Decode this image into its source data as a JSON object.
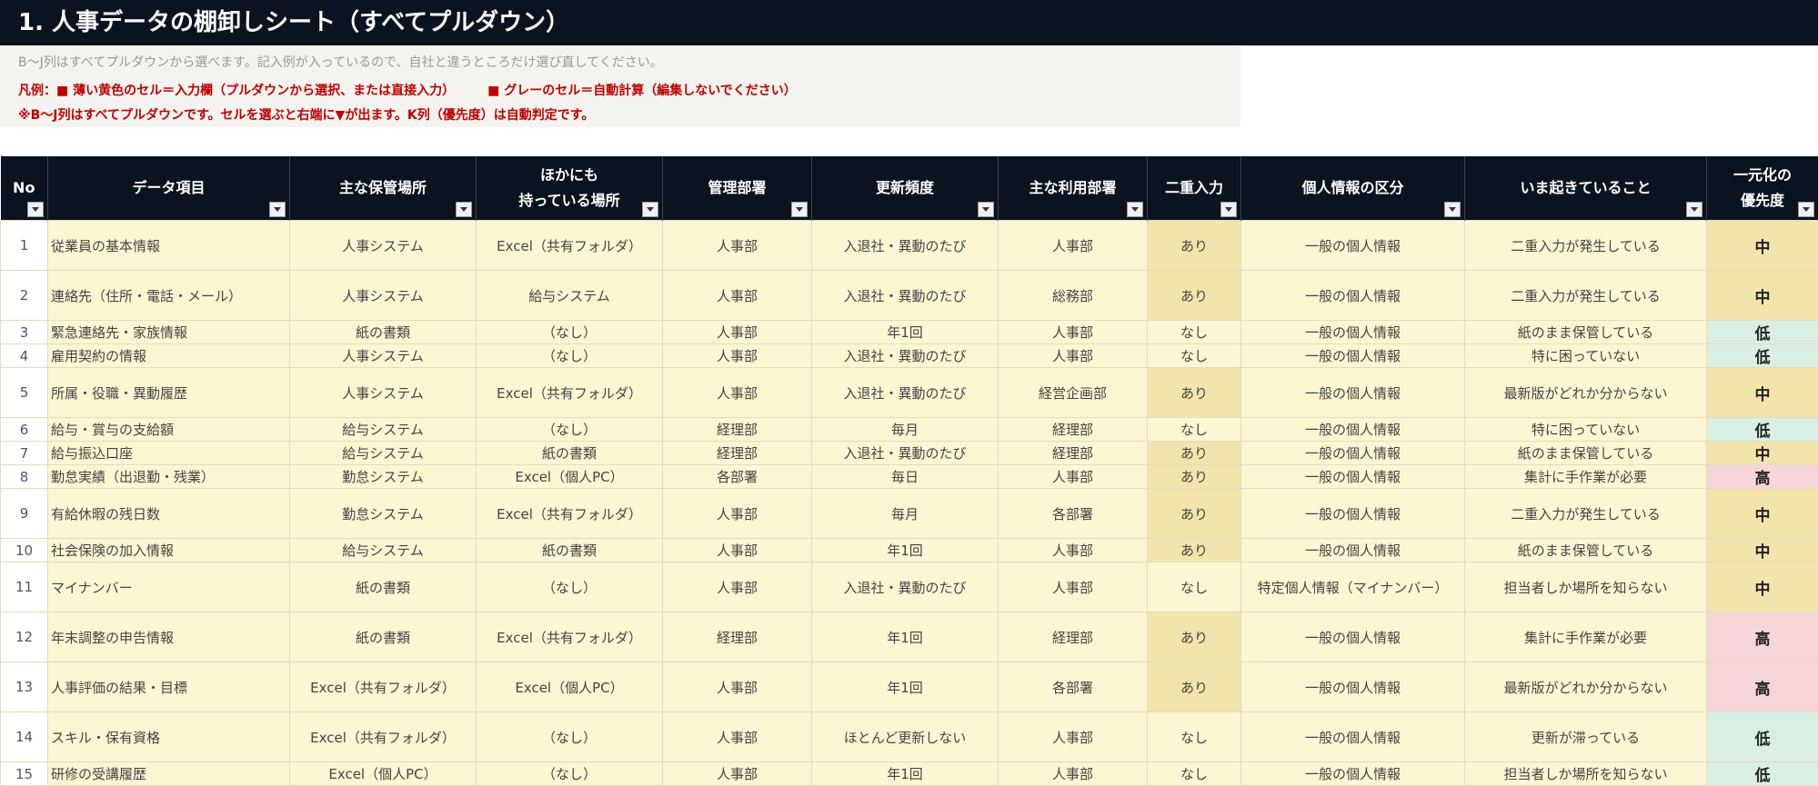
{
  "title": "1. 人事データの棚卸しシート（すべてプルダウン）",
  "subtitle": "B～J列はすべてプルダウンから選べます。記入例が入っているので、自社と違うところだけ選び直してください。",
  "legend": {
    "prefix": "凡例：",
    "yellow_text": "■ 薄い黄色のセル＝入力欄（プルダウンから選択、または直接入力）",
    "gray_text": "■ グレーのセル＝自動計算（編集しないでください）",
    "note": "※B～J列はすべてプルダウンです。セルを選ぶと右端に▼が出ます。K列（優先度）は自動判定です。"
  },
  "colors": {
    "header_bg": "#0a1320",
    "input_cell": "#fdf6d3",
    "dup_yes": "#f2e4ab",
    "priority_high": "#f6d5d8",
    "priority_mid": "#f2e4ab",
    "priority_low": "#d9efe3",
    "legend_red": "#c00000"
  },
  "table": {
    "headers": [
      {
        "l1": "No",
        "l2": ""
      },
      {
        "l1": "データ項目",
        "l2": ""
      },
      {
        "l1": "主な保管場所",
        "l2": ""
      },
      {
        "l1": "ほかにも",
        "l2": "持っている場所"
      },
      {
        "l1": "管理部署",
        "l2": ""
      },
      {
        "l1": "更新頻度",
        "l2": ""
      },
      {
        "l1": "主な利用部署",
        "l2": ""
      },
      {
        "l1": "二重入力",
        "l2": ""
      },
      {
        "l1": "個人情報の区分",
        "l2": ""
      },
      {
        "l1": "いま起きていること",
        "l2": ""
      },
      {
        "l1": "一元化の",
        "l2": "優先度"
      }
    ],
    "rows": [
      {
        "no": "1",
        "item": "従業員の基本情報",
        "storage": "人事システム",
        "other": "Excel（共有フォルダ）",
        "dept": "人事部",
        "freq": "入退社・異動のたび",
        "user": "人事部",
        "dup": "あり",
        "pii": "一般の個人情報",
        "issue": "二重入力が発生している",
        "priority": "中"
      },
      {
        "no": "2",
        "item": "連絡先（住所・電話・メール）",
        "storage": "人事システム",
        "other": "給与システム",
        "dept": "人事部",
        "freq": "入退社・異動のたび",
        "user": "総務部",
        "dup": "あり",
        "pii": "一般の個人情報",
        "issue": "二重入力が発生している",
        "priority": "中"
      },
      {
        "no": "3",
        "item": "緊急連絡先・家族情報",
        "storage": "紙の書類",
        "other": "（なし）",
        "dept": "人事部",
        "freq": "年1回",
        "user": "人事部",
        "dup": "なし",
        "pii": "一般の個人情報",
        "issue": "紙のまま保管している",
        "priority": "低"
      },
      {
        "no": "4",
        "item": "雇用契約の情報",
        "storage": "人事システム",
        "other": "（なし）",
        "dept": "人事部",
        "freq": "入退社・異動のたび",
        "user": "人事部",
        "dup": "なし",
        "pii": "一般の個人情報",
        "issue": "特に困っていない",
        "priority": "低"
      },
      {
        "no": "5",
        "item": "所属・役職・異動履歴",
        "storage": "人事システム",
        "other": "Excel（共有フォルダ）",
        "dept": "人事部",
        "freq": "入退社・異動のたび",
        "user": "経営企画部",
        "dup": "あり",
        "pii": "一般の個人情報",
        "issue": "最新版がどれか分からない",
        "priority": "中"
      },
      {
        "no": "6",
        "item": "給与・賞与の支給額",
        "storage": "給与システム",
        "other": "（なし）",
        "dept": "経理部",
        "freq": "毎月",
        "user": "経理部",
        "dup": "なし",
        "pii": "一般の個人情報",
        "issue": "特に困っていない",
        "priority": "低"
      },
      {
        "no": "7",
        "item": "給与振込口座",
        "storage": "給与システム",
        "other": "紙の書類",
        "dept": "経理部",
        "freq": "入退社・異動のたび",
        "user": "経理部",
        "dup": "あり",
        "pii": "一般の個人情報",
        "issue": "紙のまま保管している",
        "priority": "中"
      },
      {
        "no": "8",
        "item": "勤怠実績（出退勤・残業）",
        "storage": "勤怠システム",
        "other": "Excel（個人PC）",
        "dept": "各部署",
        "freq": "毎日",
        "user": "人事部",
        "dup": "あり",
        "pii": "一般の個人情報",
        "issue": "集計に手作業が必要",
        "priority": "高"
      },
      {
        "no": "9",
        "item": "有給休暇の残日数",
        "storage": "勤怠システム",
        "other": "Excel（共有フォルダ）",
        "dept": "人事部",
        "freq": "毎月",
        "user": "各部署",
        "dup": "あり",
        "pii": "一般の個人情報",
        "issue": "二重入力が発生している",
        "priority": "中"
      },
      {
        "no": "10",
        "item": "社会保険の加入情報",
        "storage": "給与システム",
        "other": "紙の書類",
        "dept": "人事部",
        "freq": "年1回",
        "user": "人事部",
        "dup": "あり",
        "pii": "一般の個人情報",
        "issue": "紙のまま保管している",
        "priority": "中"
      },
      {
        "no": "11",
        "item": "マイナンバー",
        "storage": "紙の書類",
        "other": "（なし）",
        "dept": "人事部",
        "freq": "入退社・異動のたび",
        "user": "人事部",
        "dup": "なし",
        "pii": "特定個人情報（マイナンバー）",
        "issue": "担当者しか場所を知らない",
        "priority": "中"
      },
      {
        "no": "12",
        "item": "年末調整の申告情報",
        "storage": "紙の書類",
        "other": "Excel（共有フォルダ）",
        "dept": "経理部",
        "freq": "年1回",
        "user": "経理部",
        "dup": "あり",
        "pii": "一般の個人情報",
        "issue": "集計に手作業が必要",
        "priority": "高"
      },
      {
        "no": "13",
        "item": "人事評価の結果・目標",
        "storage": "Excel（共有フォルダ）",
        "other": "Excel（個人PC）",
        "dept": "人事部",
        "freq": "年1回",
        "user": "各部署",
        "dup": "あり",
        "pii": "一般の個人情報",
        "issue": "最新版がどれか分からない",
        "priority": "高"
      },
      {
        "no": "14",
        "item": "スキル・保有資格",
        "storage": "Excel（共有フォルダ）",
        "other": "（なし）",
        "dept": "人事部",
        "freq": "ほとんど更新しない",
        "user": "人事部",
        "dup": "なし",
        "pii": "一般の個人情報",
        "issue": "更新が滞っている",
        "priority": "低"
      },
      {
        "no": "15",
        "item": "研修の受講履歴",
        "storage": "Excel（個人PC）",
        "other": "（なし）",
        "dept": "人事部",
        "freq": "年1回",
        "user": "人事部",
        "dup": "なし",
        "pii": "一般の個人情報",
        "issue": "担当者しか場所を知らない",
        "priority": "低"
      }
    ]
  }
}
